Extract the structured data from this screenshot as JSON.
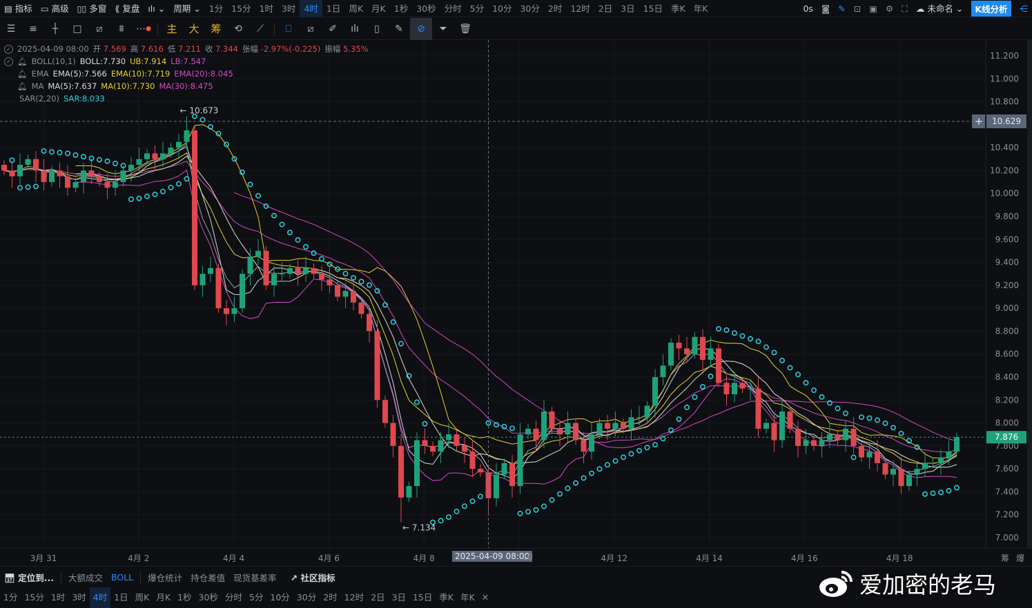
{
  "top": {
    "left": [
      "指标",
      "高级",
      "多窗",
      "复盘"
    ],
    "period": "周期",
    "timeframes": [
      "1分",
      "15分",
      "1时",
      "3时",
      "4时",
      "1日",
      "周K",
      "月K",
      "1秒",
      "30秒",
      "分时",
      "5分",
      "10分",
      "30分",
      "2时",
      "12时",
      "2日",
      "3日",
      "15日",
      "季K",
      "年K"
    ],
    "active": "4时",
    "latency": "0s",
    "layout_name": "未命名",
    "analysis_button": "K线分析"
  },
  "tools": {
    "main": "主",
    "big": "大",
    "chip": "筹"
  },
  "legend": {
    "ohlc": {
      "time": "2025-04-09 08:00",
      "o_label": "开",
      "o": "7.569",
      "h_label": "高",
      "h": "7.616",
      "l_label": "低",
      "l": "7.211",
      "c_label": "收",
      "c": "7.344",
      "chg_label": "张幅",
      "chg": "-2.97%(-0.225)",
      "amp_label": "振幅",
      "amp": "5.35%"
    },
    "boll": {
      "name": "BOLL(10,1)",
      "mid": "BOLL:7.730",
      "ub": "UB:7.914",
      "lb": "LB:7.547"
    },
    "ema": {
      "name": "EMA",
      "e5": "EMA(5):7.566",
      "e10": "EMA(10):7.719",
      "e20": "EMA(20):8.045"
    },
    "ma": {
      "name": "MA",
      "m5": "MA(5):7.637",
      "m10": "MA(10):7.730",
      "m30": "MA(30):8.475"
    },
    "sar": {
      "name": "SAR(2,20)",
      "v": "SAR:8.033"
    }
  },
  "colors": {
    "up": "#1fa27a",
    "down": "#e0484f",
    "white": "#d8dbe0",
    "yellow": "#e8d230",
    "magenta": "#d44bc4",
    "sar": "#2ad3de",
    "last": "#1fa27a"
  },
  "chart_data": {
    "type": "candlestick",
    "interval": "4h",
    "ylim": [
      7.0,
      11.2
    ],
    "yticks": [
      "11.200",
      "11.000",
      "10.800",
      "10.400",
      "10.200",
      "10.000",
      "9.800",
      "9.600",
      "9.400",
      "9.200",
      "9.000",
      "8.800",
      "8.600",
      "8.400",
      "8.200",
      "8.000",
      "7.800",
      "7.600",
      "7.400",
      "7.200",
      "7.000"
    ],
    "xticks": [
      "3月 31",
      "4月 2",
      "4月 4",
      "4月 6",
      "4月 8",
      "",
      "4月 12",
      "4月 14",
      "4月 16",
      "4月 18"
    ],
    "closes": [
      10.2,
      10.15,
      10.25,
      10.3,
      10.2,
      10.1,
      10.2,
      10.15,
      10.05,
      10.1,
      10.2,
      10.15,
      10.1,
      10.05,
      10.1,
      10.2,
      10.25,
      10.3,
      10.35,
      10.3,
      10.35,
      10.4,
      10.45,
      10.55,
      9.2,
      9.3,
      9.35,
      9.0,
      8.95,
      9.0,
      9.3,
      9.45,
      9.5,
      9.2,
      9.3,
      9.3,
      9.35,
      9.3,
      9.35,
      9.3,
      9.25,
      9.2,
      9.1,
      9.15,
      9.05,
      8.95,
      8.8,
      8.2,
      8.0,
      7.8,
      7.35,
      7.45,
      7.85,
      7.8,
      7.75,
      7.85,
      7.9,
      7.8,
      7.75,
      7.6,
      7.569,
      7.344,
      7.55,
      7.65,
      7.45,
      7.9,
      7.95,
      7.85,
      8.1,
      7.95,
      7.9,
      8.0,
      7.85,
      7.75,
      7.9,
      8.0,
      7.95,
      8.0,
      7.95,
      8.05,
      8.05,
      8.15,
      8.4,
      8.5,
      8.7,
      8.65,
      8.6,
      8.75,
      8.55,
      8.65,
      8.35,
      8.25,
      8.35,
      8.3,
      8.3,
      7.95,
      8.0,
      7.85,
      8.1,
      7.95,
      7.8,
      7.85,
      7.8,
      7.85,
      7.9,
      7.85,
      7.95,
      7.8,
      7.7,
      7.75,
      7.65,
      7.55,
      7.6,
      7.45,
      7.55,
      7.6,
      7.65,
      7.65,
      7.7,
      7.75,
      7.876
    ],
    "overrides": {
      "23": {
        "h": 10.673
      },
      "50": {
        "l": 7.134
      },
      "61": {
        "o": 7.569,
        "h": 7.616,
        "l": 7.211
      }
    },
    "max_label": "← 10.673",
    "min_label": "← 7.134",
    "crosshair_price": "10.629",
    "crosshair_time": "2025-04-09 08:00",
    "crosshair_index": 61,
    "last_price": "7.876"
  },
  "xaxis": {
    "right": [
      "筹",
      "爆"
    ],
    "after_cursor": "10"
  },
  "bottom": {
    "locate": "定位到...",
    "items": [
      "大额成交",
      "BOLL",
      "爆仓统计",
      "持仓差值",
      "现货基差率"
    ],
    "community": "社区指标"
  },
  "tf_row": [
    "1分",
    "15分",
    "1时",
    "3时",
    "4时",
    "1日",
    "周K",
    "月K",
    "1秒",
    "30秒",
    "分时",
    "5分",
    "10分",
    "30分",
    "2时",
    "12时",
    "2日",
    "3日",
    "15日",
    "季K",
    "年K"
  ],
  "watermark": "爱加密的老马"
}
